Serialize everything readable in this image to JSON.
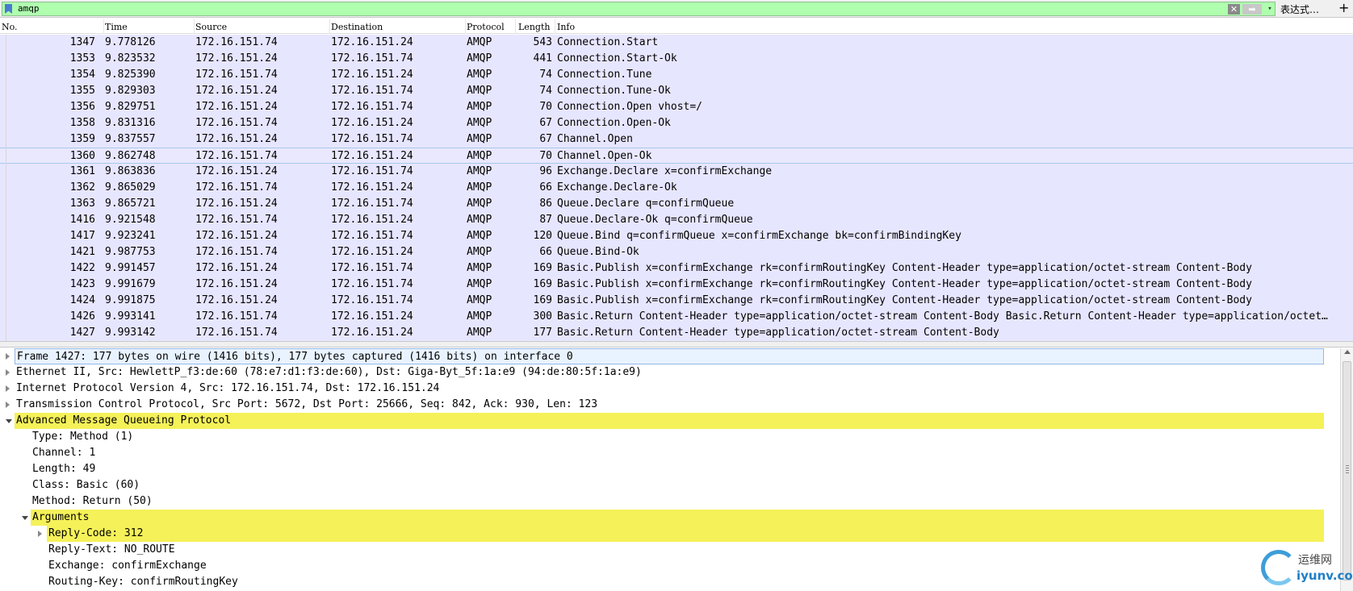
{
  "filter": {
    "text": "amqp",
    "clear_glyph": "✕",
    "apply_glyph": "➡",
    "dropdown_glyph": "▾",
    "expressions_label": "表达式…",
    "add_glyph": "+"
  },
  "columns": [
    "No.",
    "Time",
    "Source",
    "Destination",
    "Protocol",
    "Length",
    "Info"
  ],
  "packets": [
    {
      "no": "1347",
      "time": "9.778126",
      "src": "172.16.151.74",
      "dst": "172.16.151.24",
      "proto": "AMQP",
      "len": "543",
      "info": "Connection.Start"
    },
    {
      "no": "1353",
      "time": "9.823532",
      "src": "172.16.151.24",
      "dst": "172.16.151.74",
      "proto": "AMQP",
      "len": "441",
      "info": "Connection.Start-Ok"
    },
    {
      "no": "1354",
      "time": "9.825390",
      "src": "172.16.151.74",
      "dst": "172.16.151.24",
      "proto": "AMQP",
      "len": "74",
      "info": "Connection.Tune"
    },
    {
      "no": "1355",
      "time": "9.829303",
      "src": "172.16.151.24",
      "dst": "172.16.151.74",
      "proto": "AMQP",
      "len": "74",
      "info": "Connection.Tune-Ok"
    },
    {
      "no": "1356",
      "time": "9.829751",
      "src": "172.16.151.24",
      "dst": "172.16.151.74",
      "proto": "AMQP",
      "len": "70",
      "info": "Connection.Open vhost=/"
    },
    {
      "no": "1358",
      "time": "9.831316",
      "src": "172.16.151.74",
      "dst": "172.16.151.24",
      "proto": "AMQP",
      "len": "67",
      "info": "Connection.Open-Ok"
    },
    {
      "no": "1359",
      "time": "9.837557",
      "src": "172.16.151.24",
      "dst": "172.16.151.74",
      "proto": "AMQP",
      "len": "67",
      "info": "Channel.Open"
    },
    {
      "no": "1360",
      "time": "9.862748",
      "src": "172.16.151.74",
      "dst": "172.16.151.24",
      "proto": "AMQP",
      "len": "70",
      "info": "Channel.Open-Ok"
    },
    {
      "no": "1361",
      "time": "9.863836",
      "src": "172.16.151.24",
      "dst": "172.16.151.74",
      "proto": "AMQP",
      "len": "96",
      "info": "Exchange.Declare x=confirmExchange"
    },
    {
      "no": "1362",
      "time": "9.865029",
      "src": "172.16.151.74",
      "dst": "172.16.151.24",
      "proto": "AMQP",
      "len": "66",
      "info": "Exchange.Declare-Ok"
    },
    {
      "no": "1363",
      "time": "9.865721",
      "src": "172.16.151.24",
      "dst": "172.16.151.74",
      "proto": "AMQP",
      "len": "86",
      "info": "Queue.Declare q=confirmQueue"
    },
    {
      "no": "1416",
      "time": "9.921548",
      "src": "172.16.151.74",
      "dst": "172.16.151.24",
      "proto": "AMQP",
      "len": "87",
      "info": "Queue.Declare-Ok q=confirmQueue"
    },
    {
      "no": "1417",
      "time": "9.923241",
      "src": "172.16.151.24",
      "dst": "172.16.151.74",
      "proto": "AMQP",
      "len": "120",
      "info": "Queue.Bind q=confirmQueue x=confirmExchange bk=confirmBindingKey"
    },
    {
      "no": "1421",
      "time": "9.987753",
      "src": "172.16.151.74",
      "dst": "172.16.151.24",
      "proto": "AMQP",
      "len": "66",
      "info": "Queue.Bind-Ok"
    },
    {
      "no": "1422",
      "time": "9.991457",
      "src": "172.16.151.24",
      "dst": "172.16.151.74",
      "proto": "AMQP",
      "len": "169",
      "info": "Basic.Publish x=confirmExchange rk=confirmRoutingKey Content-Header type=application/octet-stream Content-Body"
    },
    {
      "no": "1423",
      "time": "9.991679",
      "src": "172.16.151.24",
      "dst": "172.16.151.74",
      "proto": "AMQP",
      "len": "169",
      "info": "Basic.Publish x=confirmExchange rk=confirmRoutingKey Content-Header type=application/octet-stream Content-Body"
    },
    {
      "no": "1424",
      "time": "9.991875",
      "src": "172.16.151.24",
      "dst": "172.16.151.74",
      "proto": "AMQP",
      "len": "169",
      "info": "Basic.Publish x=confirmExchange rk=confirmRoutingKey Content-Header type=application/octet-stream Content-Body"
    },
    {
      "no": "1426",
      "time": "9.993141",
      "src": "172.16.151.74",
      "dst": "172.16.151.24",
      "proto": "AMQP",
      "len": "300",
      "info": "Basic.Return Content-Header type=application/octet-stream Content-Body Basic.Return Content-Header type=application/octet…"
    },
    {
      "no": "1427",
      "time": "9.993142",
      "src": "172.16.151.74",
      "dst": "172.16.151.24",
      "proto": "AMQP",
      "len": "177",
      "info": "Basic.Return Content-Header type=application/octet-stream Content-Body"
    }
  ],
  "selected_packet_no": "1360",
  "details": [
    {
      "text": "Frame 1427: 177 bytes on wire (1416 bits), 177 bytes captured (1416 bits) on interface 0",
      "level": 0,
      "expander": "right",
      "style": "sel"
    },
    {
      "text": "Ethernet II, Src: HewlettP_f3:de:60 (78:e7:d1:f3:de:60), Dst: Giga-Byt_5f:1a:e9 (94:de:80:5f:1a:e9)",
      "level": 0,
      "expander": "right",
      "style": ""
    },
    {
      "text": "Internet Protocol Version 4, Src: 172.16.151.74, Dst: 172.16.151.24",
      "level": 0,
      "expander": "right",
      "style": ""
    },
    {
      "text": "Transmission Control Protocol, Src Port: 5672, Dst Port: 25666, Seq: 842, Ack: 930, Len: 123",
      "level": 0,
      "expander": "right",
      "style": ""
    },
    {
      "text": "Advanced Message Queueing Protocol",
      "level": 0,
      "expander": "down",
      "style": "hl"
    },
    {
      "text": "Type: Method (1)",
      "level": 1,
      "expander": "",
      "style": ""
    },
    {
      "text": "Channel: 1",
      "level": 1,
      "expander": "",
      "style": ""
    },
    {
      "text": "Length: 49",
      "level": 1,
      "expander": "",
      "style": ""
    },
    {
      "text": "Class: Basic (60)",
      "level": 1,
      "expander": "",
      "style": ""
    },
    {
      "text": "Method: Return (50)",
      "level": 1,
      "expander": "",
      "style": ""
    },
    {
      "text": "Arguments",
      "level": 1,
      "expander": "down",
      "style": "hl"
    },
    {
      "text": "Reply-Code: 312",
      "level": 2,
      "expander": "right",
      "style": "hl"
    },
    {
      "text": "Reply-Text: NO_ROUTE",
      "level": 2,
      "expander": "",
      "style": ""
    },
    {
      "text": "Exchange: confirmExchange",
      "level": 2,
      "expander": "",
      "style": ""
    },
    {
      "text": "Routing-Key: confirmRoutingKey",
      "level": 2,
      "expander": "",
      "style": ""
    }
  ],
  "watermark": {
    "cn": "运维网",
    "site": "iyunv.com"
  },
  "colors": {
    "filter_ok": "#afffaf",
    "row_bg": "#e7e6ff",
    "highlight": "#f5f159",
    "selection_border": "#94b9e8"
  }
}
